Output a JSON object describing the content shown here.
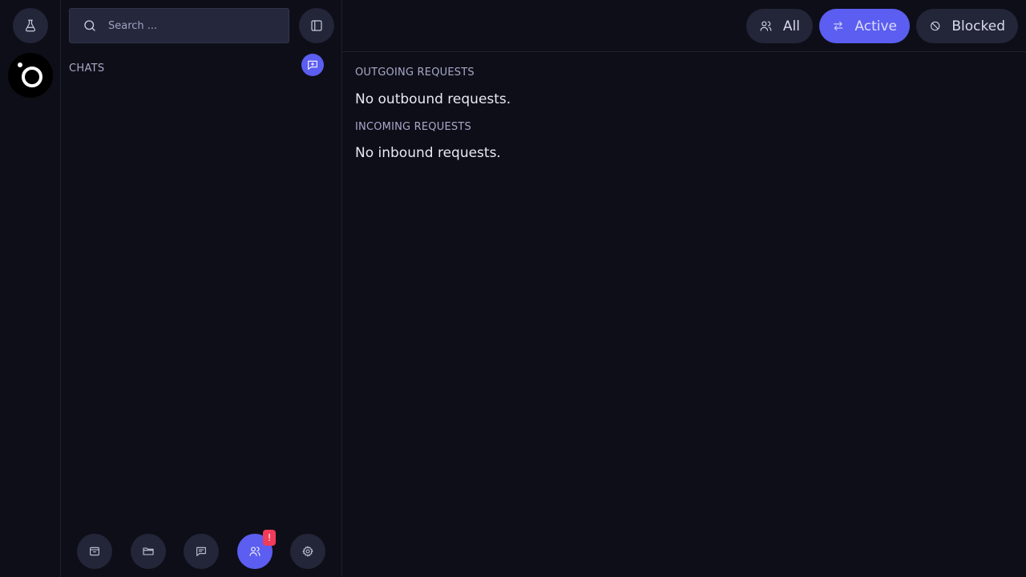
{
  "rail": {
    "lab_icon": "flask-icon",
    "logo_icon": "app-logo"
  },
  "sidebar": {
    "search": {
      "placeholder": "Search ..."
    },
    "chats_label": "CHATS",
    "new_chat_icon": "chat-add-icon",
    "bottom_nav": [
      {
        "name": "archive",
        "icon": "archive-icon",
        "active": false
      },
      {
        "name": "folder",
        "icon": "folder-icon",
        "active": false
      },
      {
        "name": "chats",
        "icon": "chat-icon",
        "active": false
      },
      {
        "name": "contacts",
        "icon": "users-icon",
        "active": true,
        "badge": "!"
      },
      {
        "name": "settings",
        "icon": "gear-icon",
        "active": false
      }
    ]
  },
  "topbar": {
    "filters": [
      {
        "label": "All",
        "icon": "users-icon",
        "active": false
      },
      {
        "label": "Active",
        "icon": "swap-arrows-icon",
        "active": true
      },
      {
        "label": "Blocked",
        "icon": "block-icon",
        "active": false
      }
    ]
  },
  "main": {
    "outgoing_label": "OUTGOING REQUESTS",
    "outgoing_empty": "No outbound requests.",
    "incoming_label": "INCOMING REQUESTS",
    "incoming_empty": "No inbound requests."
  },
  "colors": {
    "background": "#0e0e18",
    "surface": "#232538",
    "accent": "#5b5ef0",
    "badge": "#f03b5b",
    "muted_text": "#a6a9c8"
  }
}
